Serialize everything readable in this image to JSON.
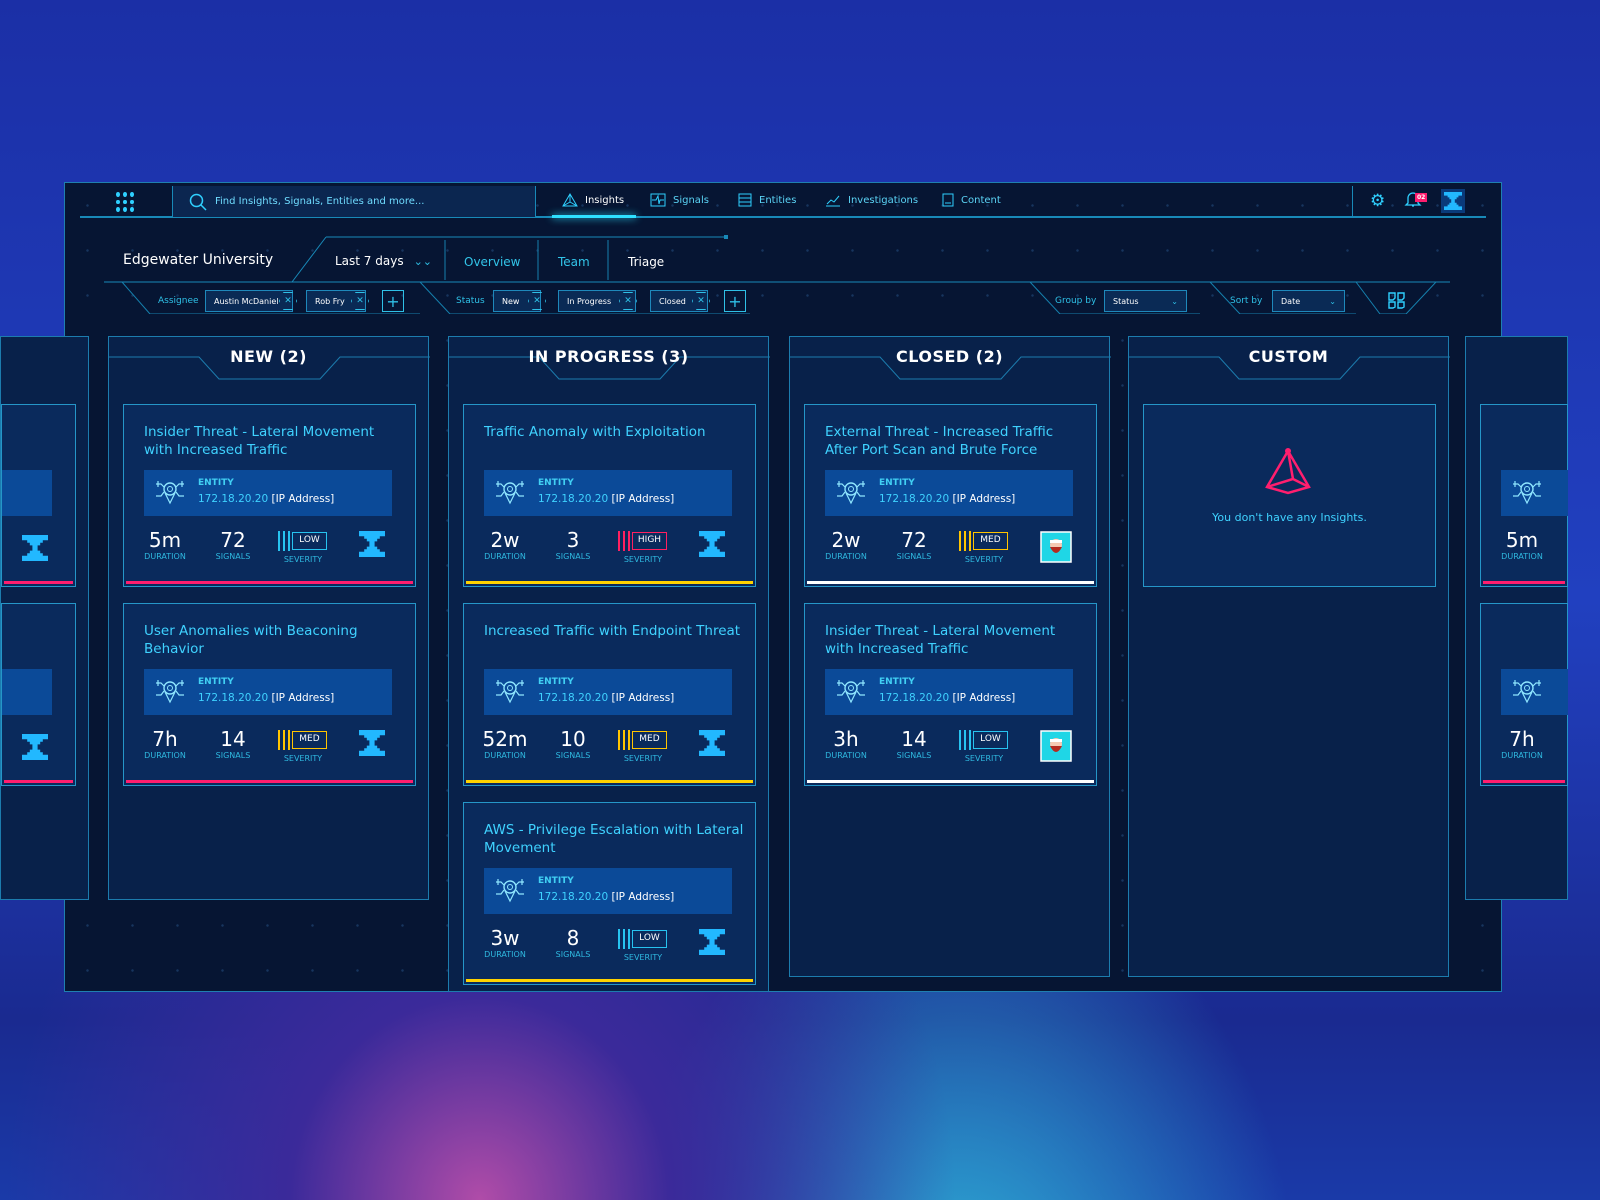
{
  "search": {
    "placeholder": "Find Insights, Signals, Entities and more..."
  },
  "nav": [
    {
      "label": "Insights",
      "icon": "triangle-icon",
      "active": true
    },
    {
      "label": "Signals",
      "icon": "signal-icon"
    },
    {
      "label": "Entities",
      "icon": "database-icon"
    },
    {
      "label": "Investigations",
      "icon": "chart-icon"
    },
    {
      "label": "Content",
      "icon": "book-icon"
    }
  ],
  "notifications": {
    "count": "02"
  },
  "header": {
    "org": "Edgewater University",
    "range": "Last 7 days",
    "tabs": [
      "Overview",
      "Team",
      "Triage"
    ],
    "active_tab": "Triage"
  },
  "filters": {
    "assignee_label": "Assignee",
    "assignees": [
      "Austin McDaniel",
      "Rob Fry"
    ],
    "status_label": "Status",
    "statuses": [
      "New",
      "In Progress",
      "Closed"
    ],
    "group_label": "Group by",
    "group_value": "Status",
    "sort_label": "Sort by",
    "sort_value": "Date"
  },
  "colors": {
    "accent": "#3fd2ff",
    "new": "#ff1e6e",
    "in_progress": "#ffd200",
    "closed": "#ffffff",
    "low": "#27c3f0",
    "med": "#ffc400",
    "high": "#ff2060"
  },
  "columns": [
    {
      "title": "NEW (2)",
      "status": "new",
      "cards": [
        {
          "title": "Insider Threat - Lateral Movement with Increased Traffic",
          "entity_label": "ENTITY",
          "ip": "172.18.20.20",
          "ip_type": "[IP Address]",
          "duration": "5m",
          "duration_label": "DURATION",
          "signals": "72",
          "signals_label": "SIGNALS",
          "severity": "LOW",
          "severity_label": "SEVERITY",
          "owner": "logo"
        },
        {
          "title": "User Anomalies with Beaconing Behavior",
          "entity_label": "ENTITY",
          "ip": "172.18.20.20",
          "ip_type": "[IP Address]",
          "duration": "7h",
          "duration_label": "DURATION",
          "signals": "14",
          "signals_label": "SIGNALS",
          "severity": "MED",
          "severity_label": "SEVERITY",
          "owner": "logo"
        }
      ]
    },
    {
      "title": "IN PROGRESS (3)",
      "status": "in_progress",
      "cards": [
        {
          "title": "Traffic Anomaly with Exploitation",
          "entity_label": "ENTITY",
          "ip": "172.18.20.20",
          "ip_type": "[IP Address]",
          "duration": "2w",
          "duration_label": "DURATION",
          "signals": "3",
          "signals_label": "SIGNALS",
          "severity": "HIGH",
          "severity_label": "SEVERITY",
          "owner": "logo"
        },
        {
          "title": "Increased Traffic with Endpoint Threat",
          "entity_label": "ENTITY",
          "ip": "172.18.20.20",
          "ip_type": "[IP Address]",
          "duration": "52m",
          "duration_label": "DURATION",
          "signals": "10",
          "signals_label": "SIGNALS",
          "severity": "MED",
          "severity_label": "SEVERITY",
          "owner": "logo"
        },
        {
          "title": "AWS - Privilege Escalation with Lateral Movement",
          "entity_label": "ENTITY",
          "ip": "172.18.20.20",
          "ip_type": "[IP Address]",
          "duration": "3w",
          "duration_label": "DURATION",
          "signals": "8",
          "signals_label": "SIGNALS",
          "severity": "LOW",
          "severity_label": "SEVERITY",
          "owner": "logo"
        }
      ]
    },
    {
      "title": "CLOSED (2)",
      "status": "closed",
      "cards": [
        {
          "title": "External Threat - Increased Traffic After Port Scan and Brute Force",
          "entity_label": "ENTITY",
          "ip": "172.18.20.20",
          "ip_type": "[IP Address]",
          "duration": "2w",
          "duration_label": "DURATION",
          "signals": "72",
          "signals_label": "SIGNALS",
          "severity": "MED",
          "severity_label": "SEVERITY",
          "owner": "avatar"
        },
        {
          "title": "Insider Threat - Lateral Movement with Increased Traffic",
          "entity_label": "ENTITY",
          "ip": "172.18.20.20",
          "ip_type": "[IP Address]",
          "duration": "3h",
          "duration_label": "DURATION",
          "signals": "14",
          "signals_label": "SIGNALS",
          "severity": "LOW",
          "severity_label": "SEVERITY",
          "owner": "avatar"
        }
      ]
    },
    {
      "title": "CUSTOM",
      "status": "custom",
      "cards": [],
      "empty_message": "You don't have any Insights."
    }
  ]
}
